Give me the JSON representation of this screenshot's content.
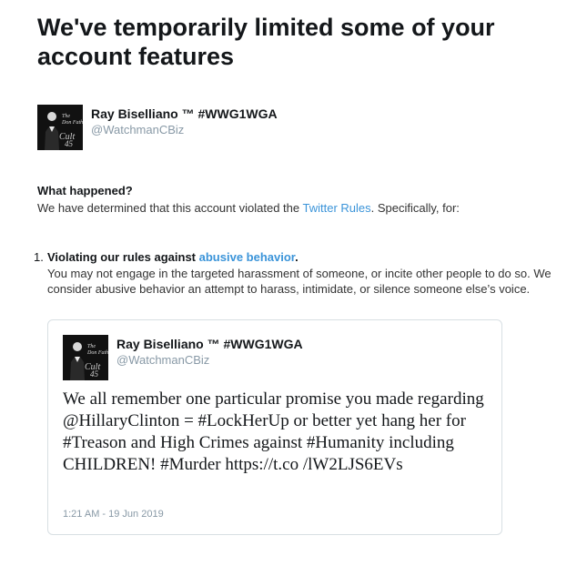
{
  "notice": {
    "title": "We've temporarily limited some of your account features"
  },
  "account": {
    "name": "Ray Biselliano ™ #WWG1WGA",
    "handle": "@WatchmanCBiz",
    "avatar_icon": "cult-45-avatar-icon"
  },
  "what_happened": {
    "heading": "What happened?",
    "text_before": "We have determined that this account violated the ",
    "link": "Twitter Rules",
    "text_after": ". Specifically, for:"
  },
  "violations": [
    {
      "number": "1.",
      "title_prefix": "Violating our rules against ",
      "title_link": "abusive behavior",
      "title_suffix": ".",
      "description": "You may not engage in the targeted harassment of someone, or incite other people to do so. We consider abusive behavior an attempt to harass, intimidate, or silence someone else’s voice."
    }
  ],
  "tweet": {
    "author_name": "Ray Biselliano ™ #WWG1WGA",
    "author_handle": "@WatchmanCBiz",
    "text": "We all remember one particular promise you made regarding @HillaryClinton = #LockHerUp or better yet hang her for #Treason and High Crimes against #Humanity including CHILDREN! #Murder https://t.co /lW2LJS6EVs",
    "timestamp": "1:21 AM - 19 Jun 2019"
  },
  "colors": {
    "link": "#3b94d9",
    "muted": "#8899a6",
    "border": "#d8dfe3"
  }
}
